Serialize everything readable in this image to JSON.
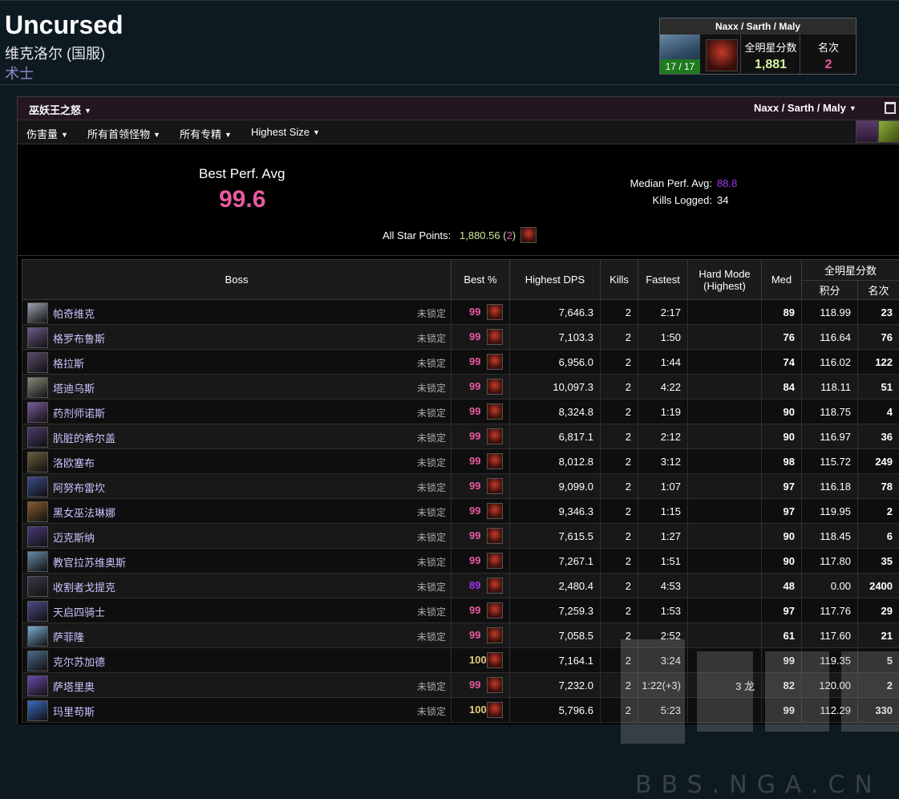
{
  "character": {
    "name": "Uncursed",
    "realm": "维克洛尔 (国服)",
    "class": "术士"
  },
  "rank_box": {
    "title": "Naxx / Sarth / Maly",
    "progress": "17 / 17",
    "points_label": "全明星分数",
    "points_value": "1,881",
    "rank_label": "名次",
    "rank_value": "2"
  },
  "toolbar": {
    "expansion": "巫妖王之怒",
    "zone": "Naxx / Sarth / Maly"
  },
  "filters": [
    {
      "label": "伤害量"
    },
    {
      "label": "所有首领怪物"
    },
    {
      "label": "所有专精"
    },
    {
      "label": "Highest Size"
    }
  ],
  "summary": {
    "bpa_label": "Best Perf. Avg",
    "bpa_value": "99.6",
    "median_label": "Median Perf. Avg:",
    "median_value": "88.8",
    "kills_label": "Kills Logged:",
    "kills_value": "34",
    "asp_label": "All Star Points:",
    "asp_value": "1,880.56",
    "asp_rank": "2"
  },
  "table": {
    "headers": {
      "boss": "Boss",
      "best": "Best %",
      "dps": "Highest DPS",
      "kills": "Kills",
      "fastest": "Fastest",
      "hardmode": "Hard Mode",
      "hardmode_sub": "(Highest)",
      "med": "Med",
      "asp": "全明星分数",
      "points": "积分",
      "rank": "名次"
    },
    "rows": [
      {
        "boss": "帕奇维克",
        "lock": "未锁定",
        "best": "99",
        "dps": "7,646.3",
        "kills": "2",
        "fastest": "2:17",
        "hm": "",
        "med": "89",
        "points": "118.99",
        "rank": "23"
      },
      {
        "boss": "格罗布鲁斯",
        "lock": "未锁定",
        "best": "99",
        "dps": "7,103.3",
        "kills": "2",
        "fastest": "1:50",
        "hm": "",
        "med": "76",
        "points": "116.64",
        "rank": "76"
      },
      {
        "boss": "格拉斯",
        "lock": "未锁定",
        "best": "99",
        "dps": "6,956.0",
        "kills": "2",
        "fastest": "1:44",
        "hm": "",
        "med": "74",
        "points": "116.02",
        "rank": "122"
      },
      {
        "boss": "塔迪乌斯",
        "lock": "未锁定",
        "best": "99",
        "dps": "10,097.3",
        "kills": "2",
        "fastest": "4:22",
        "hm": "",
        "med": "84",
        "points": "118.11",
        "rank": "51"
      },
      {
        "boss": "药剂师诺斯",
        "lock": "未锁定",
        "best": "99",
        "dps": "8,324.8",
        "kills": "2",
        "fastest": "1:19",
        "hm": "",
        "med": "90",
        "points": "118.75",
        "rank": "4"
      },
      {
        "boss": "肮脏的希尔盖",
        "lock": "未锁定",
        "best": "99",
        "dps": "6,817.1",
        "kills": "2",
        "fastest": "2:12",
        "hm": "",
        "med": "90",
        "points": "116.97",
        "rank": "36"
      },
      {
        "boss": "洛欧塞布",
        "lock": "未锁定",
        "best": "99",
        "dps": "8,012.8",
        "kills": "2",
        "fastest": "3:12",
        "hm": "",
        "med": "98",
        "points": "115.72",
        "rank": "249"
      },
      {
        "boss": "阿努布雷坎",
        "lock": "未锁定",
        "best": "99",
        "dps": "9,099.0",
        "kills": "2",
        "fastest": "1:07",
        "hm": "",
        "med": "97",
        "points": "116.18",
        "rank": "78"
      },
      {
        "boss": "黑女巫法琳娜",
        "lock": "未锁定",
        "best": "99",
        "dps": "9,346.3",
        "kills": "2",
        "fastest": "1:15",
        "hm": "",
        "med": "97",
        "points": "119.95",
        "rank": "2"
      },
      {
        "boss": "迈克斯纳",
        "lock": "未锁定",
        "best": "99",
        "dps": "7,615.5",
        "kills": "2",
        "fastest": "1:27",
        "hm": "",
        "med": "90",
        "points": "118.45",
        "rank": "6"
      },
      {
        "boss": "教官拉苏维奥斯",
        "lock": "未锁定",
        "best": "99",
        "dps": "7,267.1",
        "kills": "2",
        "fastest": "1:51",
        "hm": "",
        "med": "90",
        "points": "117.80",
        "rank": "35"
      },
      {
        "boss": "收割者戈提克",
        "lock": "未锁定",
        "best": "89",
        "dps": "2,480.4",
        "kills": "2",
        "fastest": "4:53",
        "hm": "",
        "med": "48",
        "points": "0.00",
        "rank": "2400"
      },
      {
        "boss": "天启四骑士",
        "lock": "未锁定",
        "best": "99",
        "dps": "7,259.3",
        "kills": "2",
        "fastest": "1:53",
        "hm": "",
        "med": "97",
        "points": "117.76",
        "rank": "29"
      },
      {
        "boss": "萨菲隆",
        "lock": "未锁定",
        "best": "99",
        "dps": "7,058.5",
        "kills": "2",
        "fastest": "2:52",
        "hm": "",
        "med": "61",
        "points": "117.60",
        "rank": "21"
      },
      {
        "boss": "克尔苏加德",
        "lock": "",
        "best": "100",
        "dps": "7,164.1",
        "kills": "2",
        "fastest": "3:24",
        "hm": "",
        "med": "99",
        "points": "119.35",
        "rank": "5"
      },
      {
        "boss": "萨塔里奥",
        "lock": "未锁定",
        "best": "99",
        "dps": "7,232.0",
        "kills": "2",
        "fastest": "1:22(+3)",
        "hm": "3 龙",
        "med": "82",
        "points": "120.00",
        "rank": "2"
      },
      {
        "boss": "玛里苟斯",
        "lock": "未锁定",
        "best": "100",
        "dps": "5,796.6",
        "kills": "2",
        "fastest": "5:23",
        "hm": "",
        "med": "99",
        "points": "112.29",
        "rank": "330"
      }
    ]
  },
  "watermark": {
    "text": "BBS.NGA.CN"
  },
  "colors": {
    "artifact": "#e5cc80",
    "legendary": "#ff8000",
    "epic": "#a335ee",
    "rare": "#1e90ff",
    "uncommon": "#1eff00",
    "astounding": "#e85ba0"
  }
}
